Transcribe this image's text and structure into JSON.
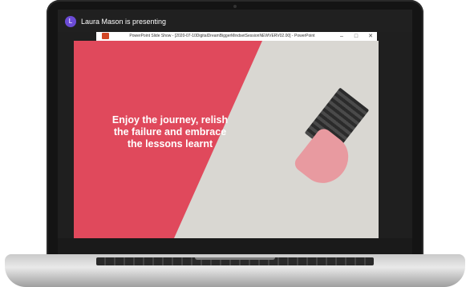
{
  "presenter": {
    "avatar_initial": "L",
    "status_text": "Laura Mason is presenting",
    "avatar_color": "#6b4bd6"
  },
  "window": {
    "title": "PowerPoint Slide Show - [2020-07-10DigitalDreamBiggerMindsetSessionNEWVERV02.00] - PowerPoint",
    "minimize_glyph": "–",
    "maximize_glyph": "□",
    "close_glyph": "✕",
    "app_icon": "powerpoint-icon"
  },
  "slide": {
    "headline": "Enjoy the journey, relish the failure and embrace the lessons learnt",
    "accent_color": "#e0495c",
    "image_subject": "pencil-eraser-image"
  }
}
